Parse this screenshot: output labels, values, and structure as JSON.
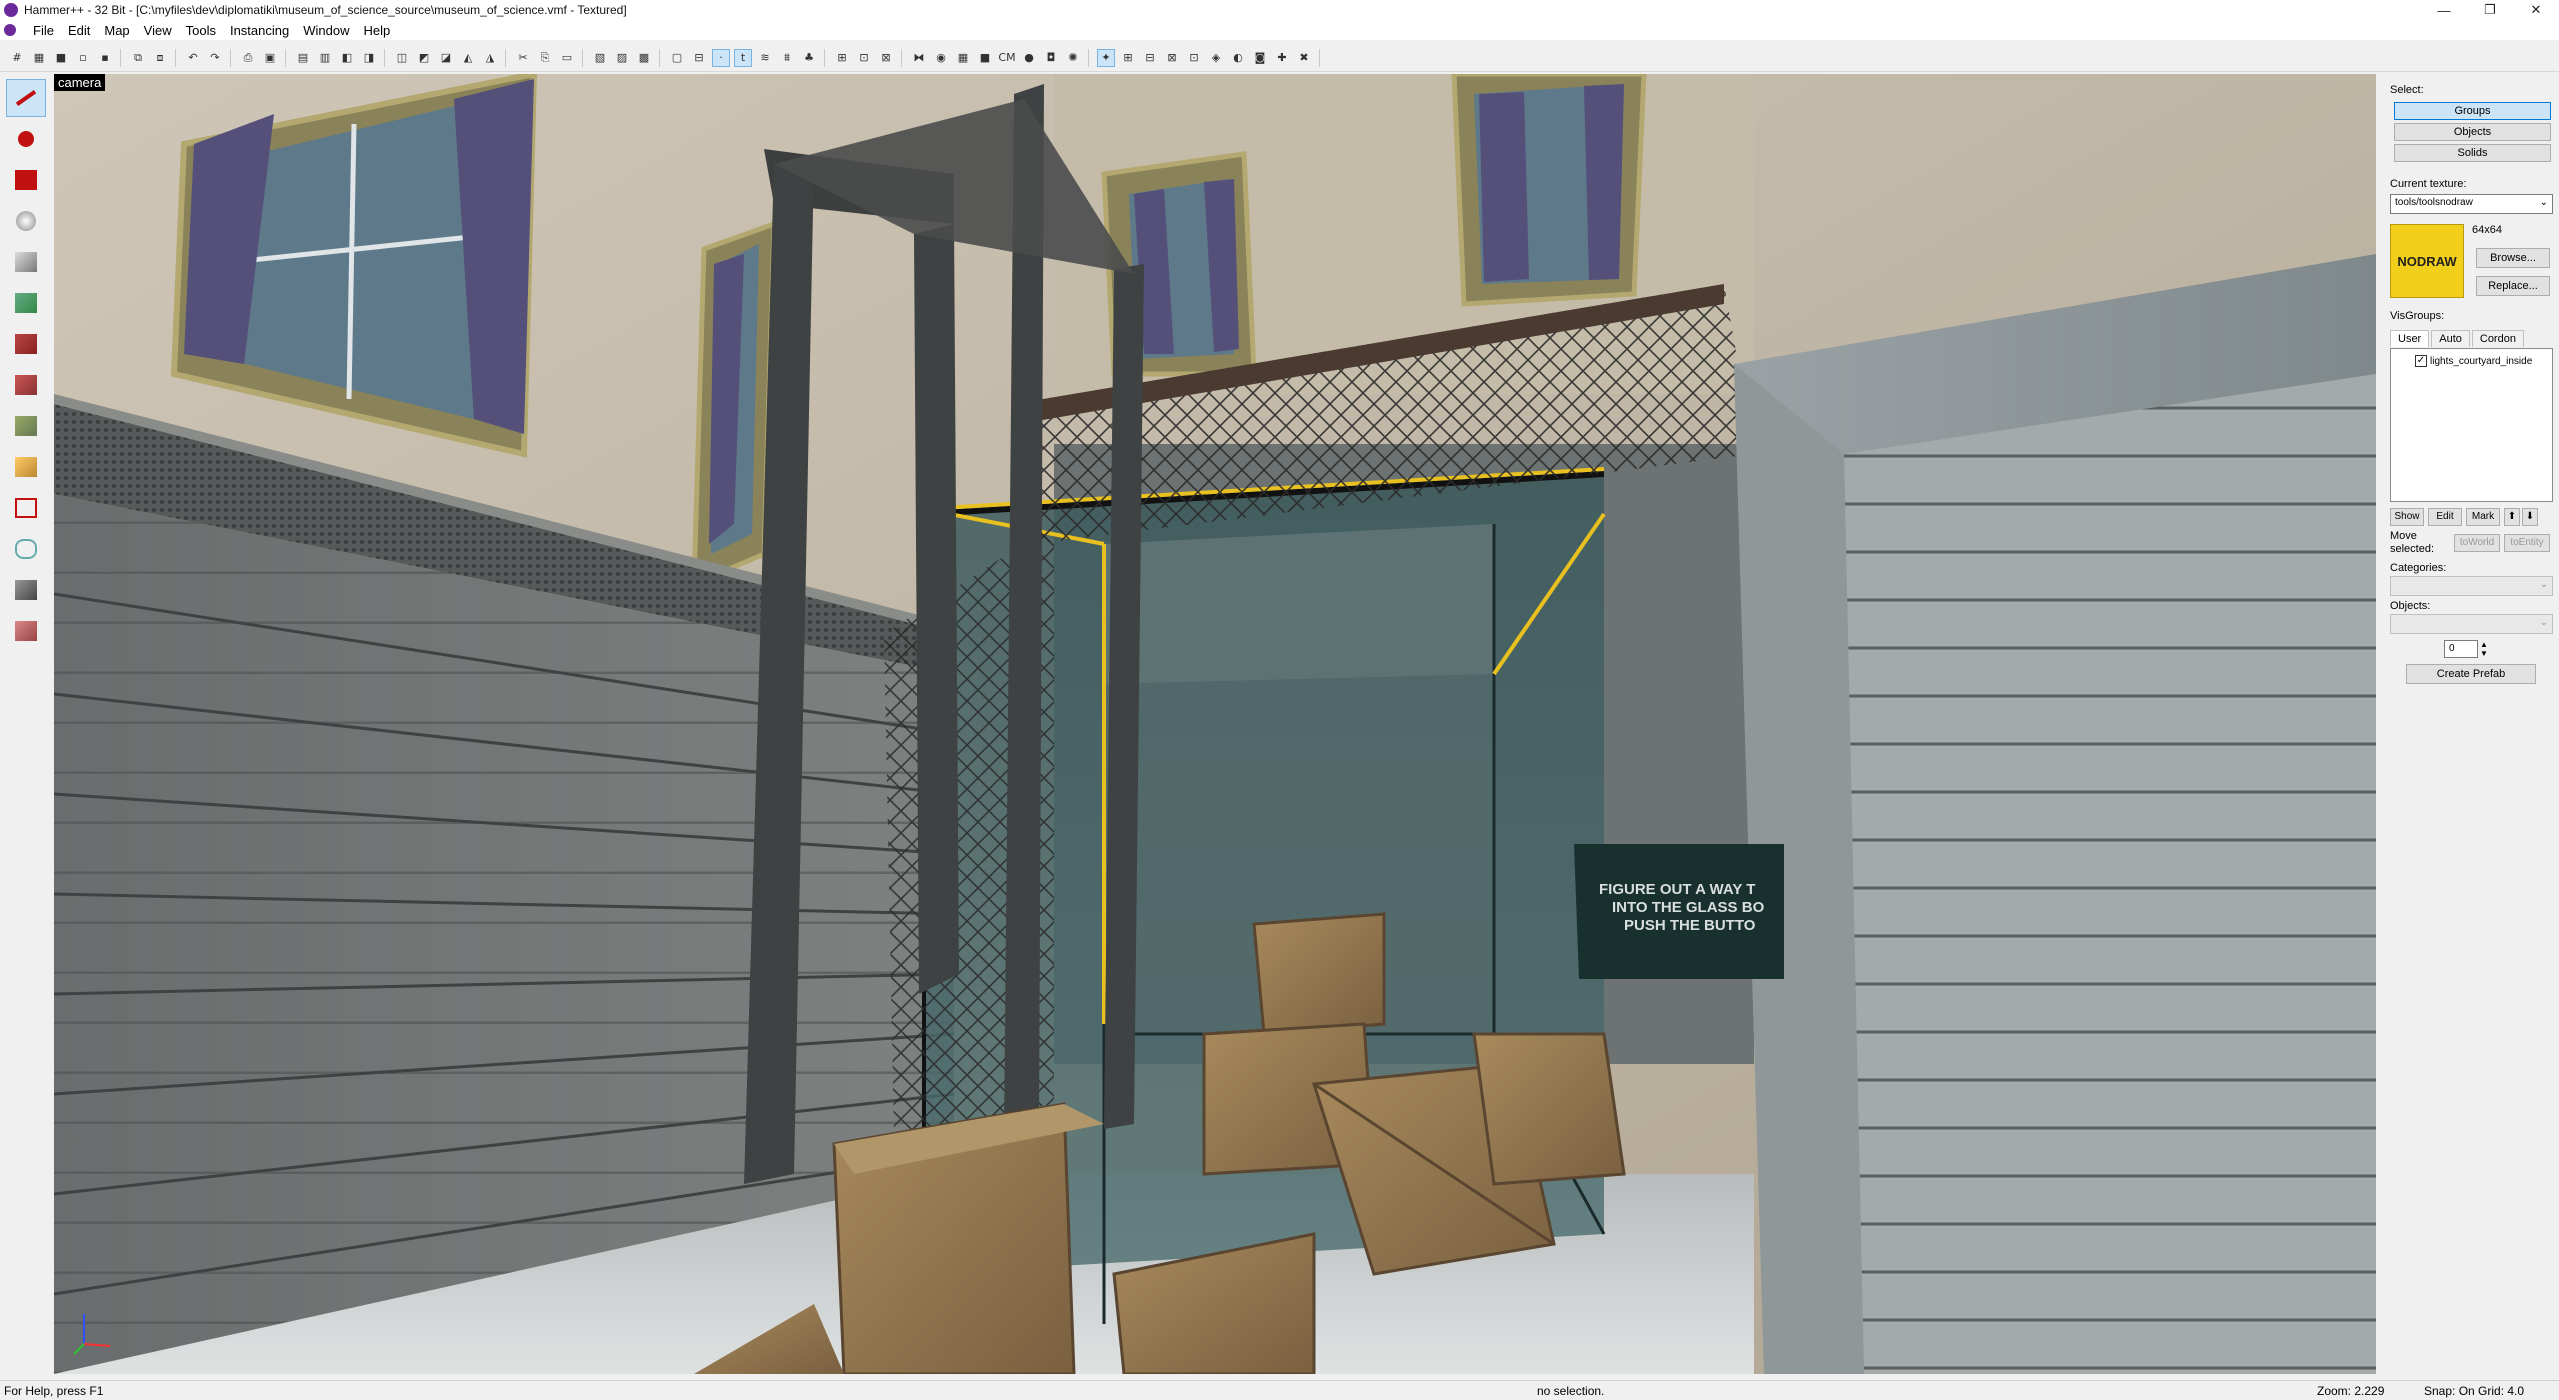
{
  "window": {
    "title": "Hammer++ - 32 Bit - [C:\\myfiles\\dev\\diplomatiki\\museum_of_science_source\\museum_of_science.vmf - Textured]",
    "controls": [
      "—",
      "❐",
      "✕"
    ]
  },
  "menu": [
    "File",
    "Edit",
    "Map",
    "View",
    "Tools",
    "Instancing",
    "Window",
    "Help"
  ],
  "viewport": {
    "label": "camera",
    "sign_lines": [
      "FIGURE OUT A WAY T",
      "INTO THE GLASS BO",
      "PUSH THE BUTTO"
    ]
  },
  "panel": {
    "select_label": "Select:",
    "select_buttons": [
      "Groups",
      "Objects",
      "Solids"
    ],
    "current_texture_label": "Current texture:",
    "texture_value": "tools/toolsnodraw",
    "texture_preview_text": "NODRAW",
    "texture_size": "64x64",
    "browse_label": "Browse...",
    "replace_label": "Replace...",
    "visgroups_label": "VisGroups:",
    "vis_tabs": [
      "User",
      "Auto",
      "Cordon"
    ],
    "vis_item": "lights_courtyard_inside",
    "show_label": "Show",
    "edit_label": "Edit",
    "mark_label": "Mark",
    "up_label": "⬆",
    "down_label": "⬇",
    "move_selected_label_1": "Move",
    "move_selected_label_2": "selected:",
    "to_world_label": "toWorld",
    "to_entity_label": "toEntity",
    "categories_label": "Categories:",
    "objects_label": "Objects:",
    "count_value": "0",
    "create_prefab_label": "Create Prefab"
  },
  "status": {
    "help": "For Help, press F1",
    "selection": "no selection.",
    "zoom": "Zoom: 2.229",
    "snap": "Snap: On Grid: 4.0"
  },
  "colors": {
    "accent": "#0078d7",
    "nodraw": "#f2cf1a",
    "highlight_yellow": "#e8c020"
  }
}
